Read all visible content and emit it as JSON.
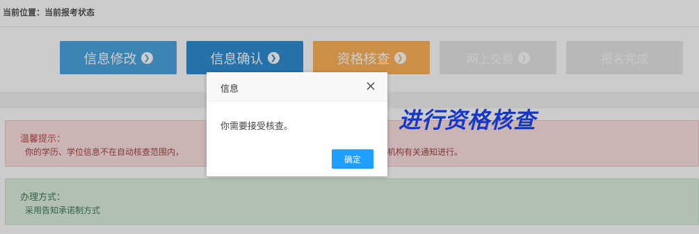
{
  "breadcrumb": "当前位置：当前报考状态",
  "steps": [
    {
      "label": "信息修改",
      "icon": "arrow-circle-right-icon"
    },
    {
      "label": "信息确认",
      "icon": "arrow-circle-right-icon"
    },
    {
      "label": "资格核查",
      "icon": "arrow-circle-right-icon"
    },
    {
      "label": "网上交费",
      "icon": "arrow-circle-right-icon"
    },
    {
      "label": "报名完成"
    }
  ],
  "warning": {
    "title": "温馨提示：",
    "text_left": "你的学历、学位信息不在自动核查范围内，",
    "text_right": "考试机构有关通知进行。"
  },
  "method": {
    "title": "办理方式：",
    "text": "采用告知承诺制方式"
  },
  "annotation": "进行资格核查",
  "dialog": {
    "title": "信息",
    "message": "你需要接受核查。",
    "confirm_label": "确定"
  },
  "colors": {
    "step_edit": "#4ca6e0",
    "step_confirm": "#2f8fd6",
    "step_check": "#ffb359",
    "step_disabled": "#e7e7e7",
    "dialog_button": "#1e9fff",
    "annotation": "#1737c9"
  }
}
